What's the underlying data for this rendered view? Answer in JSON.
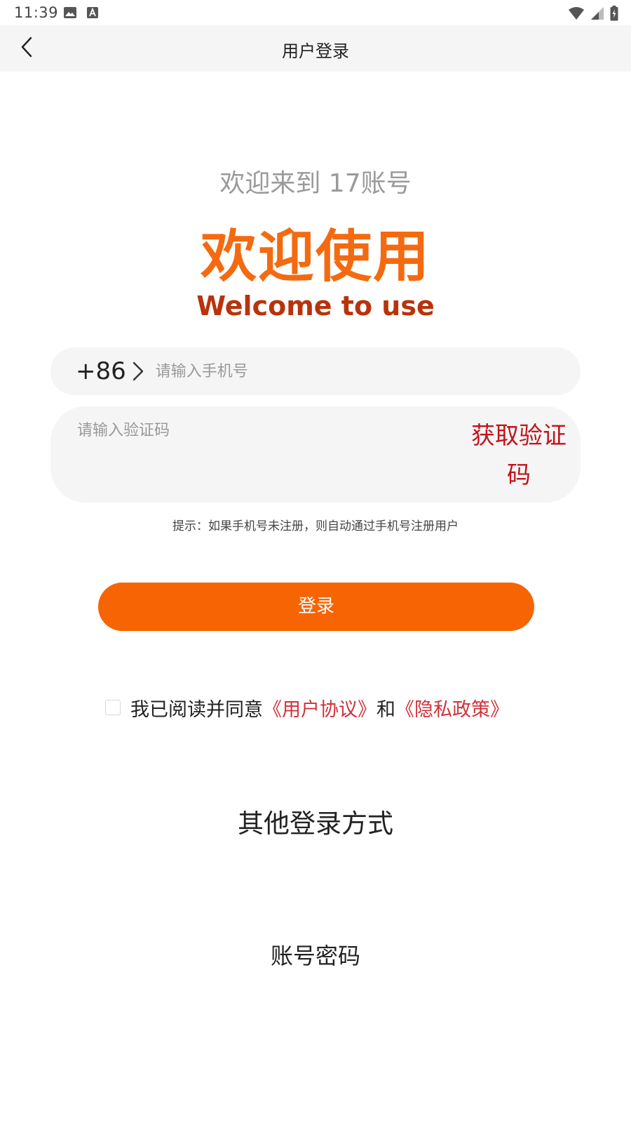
{
  "status_bar": {
    "time": "11:39",
    "icons": [
      "image-icon",
      "font-icon",
      "wifi-icon",
      "signal-icon",
      "battery-icon"
    ]
  },
  "header": {
    "title": "用户登录",
    "back_icon": "chevron-left-icon"
  },
  "welcome_text": "欢迎来到 17账号",
  "logo": {
    "cn": "欢迎使用",
    "en": "Welcome to use",
    "colors": {
      "cn": "#f46a10",
      "en": "#b8330c"
    }
  },
  "phone": {
    "country_code": "+86",
    "placeholder": "请输入手机号",
    "value": ""
  },
  "code": {
    "placeholder": "请输入验证码",
    "value": "",
    "get_code_label_line1": "获取验证",
    "get_code_label_line2": "码"
  },
  "hint": "提示：如果手机号未注册，则自动通过手机号注册用户",
  "login_button": {
    "label": "登录",
    "color": "#f76404"
  },
  "agreement": {
    "checked": false,
    "prefix": "我已阅读并同意",
    "user_agreement": "《用户协议》",
    "and": "和",
    "privacy_policy": "《隐私政策》",
    "link_color": "#d0323b"
  },
  "other_login": {
    "title": "其他登录方式",
    "account_password": "账号密码"
  }
}
